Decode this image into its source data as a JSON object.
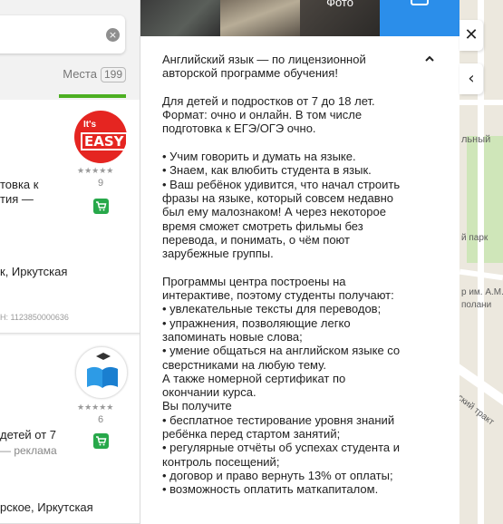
{
  "search": {
    "value": "",
    "clear_icon": "close-circle-icon"
  },
  "tabs": {
    "places_label": "Места",
    "places_count": "199"
  },
  "results": [
    {
      "logo_text_top": "It's",
      "logo_text_main": "EASY",
      "logo_color": "#e52521",
      "rating_count": "9",
      "title_fragment_1": "товка к",
      "title_fragment_2": "тия —",
      "address_fragment": "к, Иркутская",
      "id_fragment": "Н: 1123850000636"
    },
    {
      "rating_count": "6",
      "title_fragment": "детей от 7",
      "ad_fragment": "— реклама",
      "address_fragment": "рское, Иркутская"
    }
  ],
  "photos": {
    "caption_3": "Фото"
  },
  "description": {
    "paragraphs": [
      "Английский язык — по лицензионной\nавторской программе обучения!",
      "Для детей и подростков от 7 до 18 лет.\nФормат: очно и онлайн. В том числе\nподготовка к ЕГЭ/ОГЭ очно.",
      "• Учим говорить и думать на языке.\n• Знаем, как влюбить студента в язык.\n• Ваш ребёнок удивится, что начал строить\nфразы на языке, который совсем недавно\nбыл ему малознаком! А через некоторое\nвремя сможет смотреть фильмы без\nперевода, и понимать, о чём поют\nзарубежные группы.",
      "Программы центра построены на\nинтерактиве, поэтому студенты получают:\n• увлекательные тексты для переводов;\n• упражнения, позволяющие легко\nзапоминать новые слова;\n• умение общаться на английском языке со\nсверстниками на любую тему.\nА также номерной сертификат по\nокончании курса.\nВы получите\n• бесплатное тестирование уровня знаний\nребёнка перед стартом занятий;\n• регулярные отчёты об успехах студента и\nконтроль посещений;\n• договор и право вернуть 13% от оплаты;\n• возможность оплатить маткапиталом."
    ]
  },
  "controls": {
    "close_glyph": "✕",
    "collapse_glyph": "‹"
  },
  "map": {
    "labels": [
      "льный",
      "й парк",
      "р им. А.М.",
      "полани",
      "вский тракт"
    ]
  },
  "colors": {
    "accent_green": "#4caf22",
    "cart_green": "#27a84a",
    "photo_highlight": "#2b8eea"
  }
}
